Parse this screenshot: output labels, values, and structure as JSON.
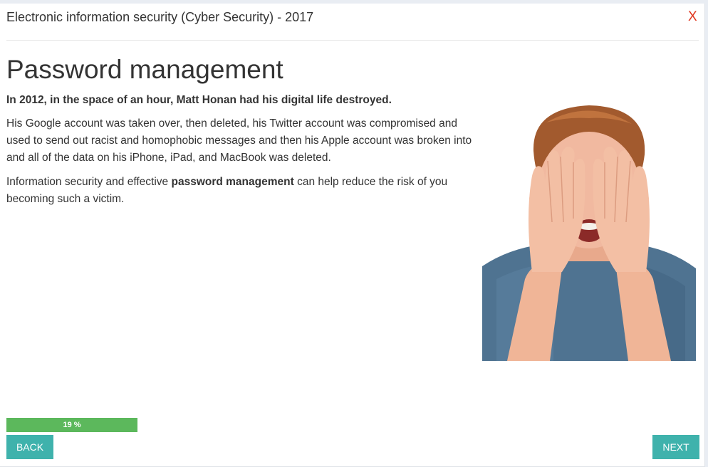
{
  "header": {
    "title": "Electronic information security (Cyber Security) - 2017",
    "close_label": "X"
  },
  "content": {
    "title": "Password management",
    "lead": "In 2012, in the space of an hour, Matt Honan had his digital life destroyed.",
    "paragraph1": "His Google account was taken over, then deleted, his Twitter account was compromised and used  to send out racist and homophobic messages and then his Apple account was broken into and all of the data on his iPhone, iPad, and MacBook was deleted.",
    "paragraph2": {
      "before": "Information security and effective ",
      "bold": "password management",
      "after": " can help reduce the risk of you becoming such a victim."
    }
  },
  "progress": {
    "percent": 19,
    "label": "19 %"
  },
  "nav": {
    "back_label": "BACK",
    "next_label": "NEXT"
  },
  "colors": {
    "accent": "#3fb2ac",
    "progress": "#5cb85c",
    "close": "#e0341c"
  }
}
